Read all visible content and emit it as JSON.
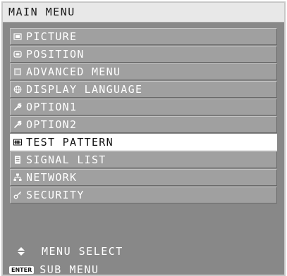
{
  "menu": {
    "title": "MAIN MENU",
    "items": [
      {
        "label": "PICTURE",
        "icon": "picture-icon",
        "selected": false
      },
      {
        "label": "POSITION",
        "icon": "position-icon",
        "selected": false
      },
      {
        "label": "ADVANCED MENU",
        "icon": "advanced-menu-icon",
        "selected": false
      },
      {
        "label": "DISPLAY LANGUAGE",
        "icon": "globe-icon",
        "selected": false
      },
      {
        "label": "OPTION1",
        "icon": "wrench-icon",
        "selected": false
      },
      {
        "label": "OPTION2",
        "icon": "wrench-icon",
        "selected": false
      },
      {
        "label": "TEST PATTERN",
        "icon": "test-pattern-icon",
        "selected": true
      },
      {
        "label": "SIGNAL LIST",
        "icon": "signal-list-icon",
        "selected": false
      },
      {
        "label": "NETWORK",
        "icon": "network-icon",
        "selected": false
      },
      {
        "label": "SECURITY",
        "icon": "key-icon",
        "selected": false
      }
    ]
  },
  "footer": {
    "select_label": "MENU SELECT",
    "enter_key": "ENTER",
    "submenu_label": "SUB MENU"
  },
  "colors": {
    "panel_bg": "#888888",
    "item_bg": "#a0a0a0",
    "selected_bg": "#ffffff",
    "title_bg": "#e8e8e8"
  }
}
